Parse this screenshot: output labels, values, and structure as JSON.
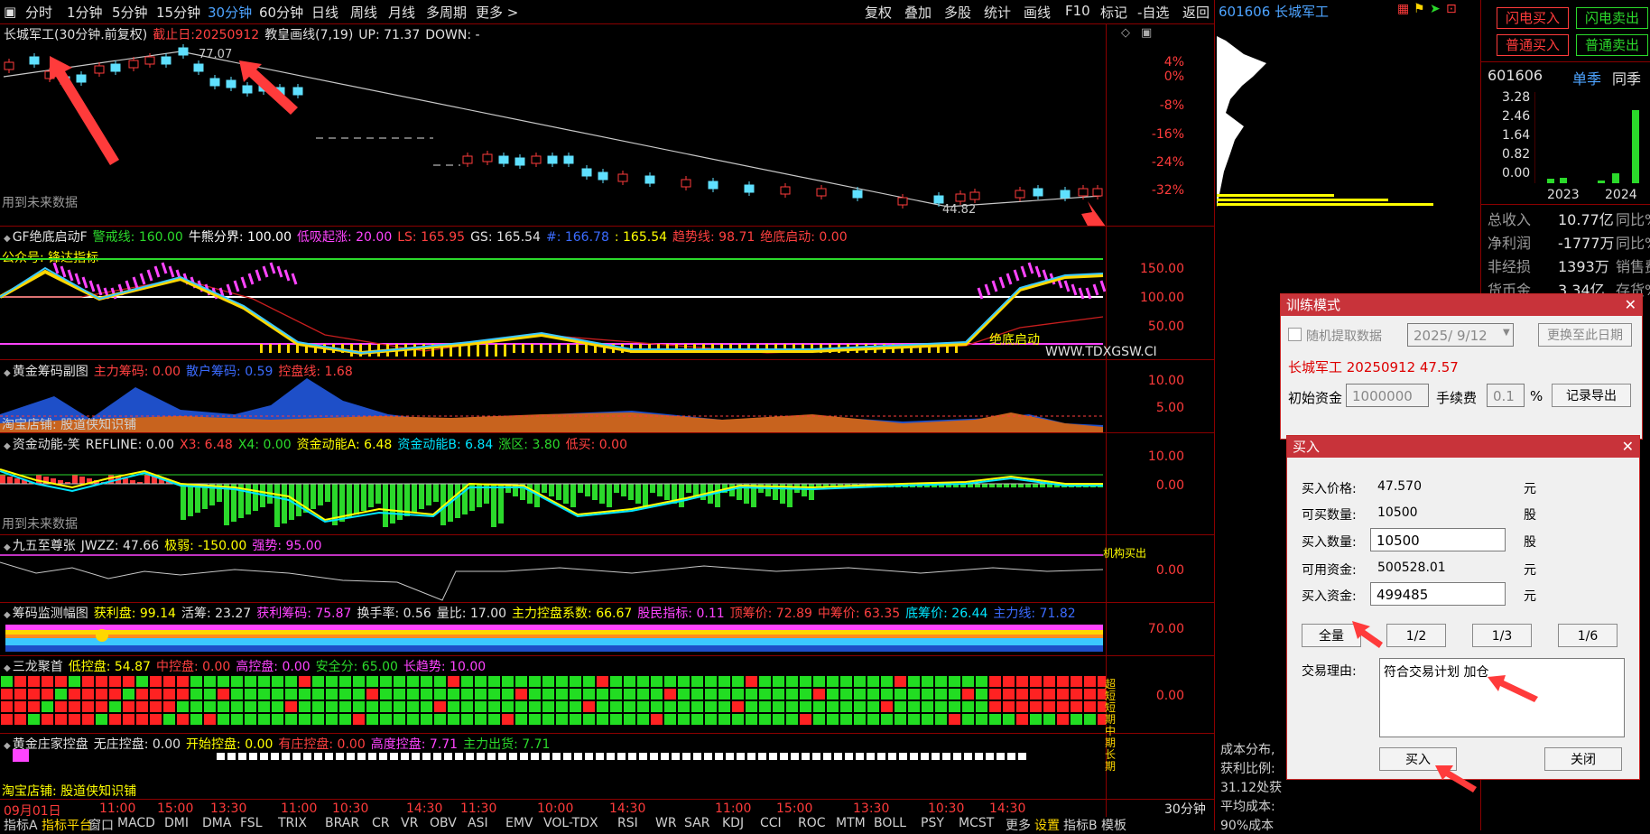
{
  "period_tabs": [
    "分时",
    "1分钟",
    "5分钟",
    "15分钟",
    "30分钟",
    "60分钟",
    "日线",
    "周线",
    "月线",
    "多周期",
    "更多 >"
  ],
  "active_period": "30分钟",
  "toolbar": [
    "复权",
    "叠加",
    "多股",
    "统计",
    "画线",
    "F10",
    "标记",
    "-自选",
    "返回"
  ],
  "stock": {
    "code": "601606",
    "name": "长城军工"
  },
  "main_chart": {
    "title": "长城军工(30分钟.前复权)",
    "deadline": "截止日:20250912",
    "indicator": "教皇画线(7,19)",
    "up": "UP: 71.37",
    "down": "DOWN: -",
    "high_label": "77.07",
    "low_label": "44.82",
    "future_note": "用到未来数据",
    "y_ticks": [
      "4%",
      "0%",
      "-8%",
      "-16%",
      "-24%",
      "-32%"
    ]
  },
  "panel2": {
    "name": "GF绝底启动F",
    "items": [
      {
        "t": "警戒线: 160.00",
        "c": "#2bd92b"
      },
      {
        "t": "牛熊分界: 100.00",
        "c": "#ffffff"
      },
      {
        "t": "低吸起涨: 20.00",
        "c": "#ff44ff"
      },
      {
        "t": "LS: 165.95",
        "c": "#ff4040"
      },
      {
        "t": "GS: 165.54",
        "c": "#e0e0e0"
      },
      {
        "t": "#: 166.78",
        "c": "#3b6bff"
      },
      {
        "t": ": 165.54",
        "c": "#ffff00"
      },
      {
        "t": "趋势线: 98.71",
        "c": "#ff4040"
      },
      {
        "t": "绝底启动: 0.00",
        "c": "#ff4040"
      }
    ],
    "sublabel": "公众号: 锋达指标",
    "y_ticks": [
      "150.00",
      "100.00",
      "50.00"
    ],
    "watermark": "WWW.TDXGSW.CI",
    "start_label": "绝底启动"
  },
  "panel3": {
    "name": "黄金筹码副图",
    "items": [
      {
        "t": "主力筹码: 0.00",
        "c": "#ff4040"
      },
      {
        "t": "散户筹码: 0.59",
        "c": "#3b6bff"
      },
      {
        "t": "控盘线: 1.68",
        "c": "#ff4040"
      }
    ],
    "y_ticks": [
      "10.00",
      "5.00"
    ],
    "sublabel": "淘宝店铺: 股道侠知识铺"
  },
  "panel4": {
    "name": "资金动能-笑",
    "items": [
      {
        "t": "REFLINE: 0.00",
        "c": "#e0e0e0"
      },
      {
        "t": "X3: 6.48",
        "c": "#ff4040"
      },
      {
        "t": "X4: 0.00",
        "c": "#2bd92b"
      },
      {
        "t": "资金动能A: 6.48",
        "c": "#ffff00"
      },
      {
        "t": "资金动能B: 6.84",
        "c": "#00e5ff"
      },
      {
        "t": "涨区: 3.80",
        "c": "#2bd92b"
      },
      {
        "t": "低买: 0.00",
        "c": "#ff4040"
      }
    ],
    "y_ticks": [
      "10.00",
      "0.00"
    ],
    "future_note": "用到未来数据"
  },
  "panel5": {
    "name": "九五至尊张",
    "items": [
      {
        "t": "JWZZ: 47.66",
        "c": "#e0e0e0"
      },
      {
        "t": "极弱: -150.00",
        "c": "#ffff00"
      },
      {
        "t": "强势: 95.00",
        "c": "#ff44ff"
      }
    ],
    "y_ticks": [
      "0.00"
    ],
    "corner": "机构买出"
  },
  "panel6": {
    "name": "筹码监测幅图",
    "items": [
      {
        "t": "获利盘: 99.14",
        "c": "#ffff00"
      },
      {
        "t": "活筹: 23.27",
        "c": "#e0e0e0"
      },
      {
        "t": "获利筹码: 75.87",
        "c": "#ff44ff"
      },
      {
        "t": "换手率: 0.56",
        "c": "#e0e0e0"
      },
      {
        "t": "量比: 17.00",
        "c": "#e0e0e0"
      },
      {
        "t": "主力控盘系数: 66.67",
        "c": "#ffff00"
      },
      {
        "t": "股民指标: 0.11",
        "c": "#ff44ff"
      },
      {
        "t": "顶筹价: 72.89",
        "c": "#ff4040"
      },
      {
        "t": "中筹价: 63.35",
        "c": "#ff4040"
      },
      {
        "t": "底筹价: 26.44",
        "c": "#00e5ff"
      },
      {
        "t": "主力线: 71.82",
        "c": "#3b6bff"
      }
    ],
    "y_ticks": [
      "70.00"
    ]
  },
  "panel7": {
    "name": "三龙聚首",
    "items": [
      {
        "t": "低控盘: 54.87",
        "c": "#ffff00"
      },
      {
        "t": "中控盘: 0.00",
        "c": "#ff4040"
      },
      {
        "t": "高控盘: 0.00",
        "c": "#ff44ff"
      },
      {
        "t": "安全分: 65.00",
        "c": "#2bd92b"
      },
      {
        "t": "长趋势: 10.00",
        "c": "#ff44ff"
      }
    ],
    "y_ticks": [
      "0.00"
    ],
    "side_labels": [
      "超短",
      "短期",
      "中期",
      "长期"
    ]
  },
  "panel8": {
    "name": "黄金庄家控盘",
    "items": [
      {
        "t": "无庄控盘: 0.00",
        "c": "#e0e0e0"
      },
      {
        "t": "开始控盘: 0.00",
        "c": "#ffff00"
      },
      {
        "t": "有庄控盘: 0.00",
        "c": "#ff4040"
      },
      {
        "t": "高度控盘: 7.71",
        "c": "#ff44ff"
      },
      {
        "t": "主力出货: 7.71",
        "c": "#2bd92b"
      }
    ],
    "sublabel": "淘宝店铺: 股道侠知识铺"
  },
  "time_axis": [
    "09月01日",
    "11:00",
    "15:00",
    "13:30",
    "11:00",
    "10:30",
    "14:30",
    "11:30",
    "10:00",
    "14:30",
    "11:00",
    "15:00",
    "13:30",
    "10:30",
    "14:30"
  ],
  "bottom_tabs": [
    "指标A",
    "指标平台",
    "窗口",
    "MACD",
    "DMI",
    "DMA",
    "FSL",
    "TRIX",
    "BRAR",
    "CR",
    "VR",
    "OBV",
    "ASI",
    "EMV",
    "VOL-TDX",
    "RSI",
    "WR",
    "SAR",
    "KDJ",
    "CCI",
    "ROC",
    "MTM",
    "BOLL",
    "PSY",
    "MCST",
    "更多",
    "设置",
    "指标B",
    "模板"
  ],
  "corner_period": "30分钟",
  "right_panel": {
    "code_name": "601606 长城军工",
    "btn_flash_buy": "闪电买入",
    "btn_flash_sell": "闪电卖出",
    "btn_normal_buy": "普通买入",
    "btn_normal_sell": "普通卖出",
    "fin_code": "601606",
    "fin_tab1": "单季",
    "fin_tab2": "同季",
    "fin_ticks": [
      "3.28",
      "2.46",
      "1.64",
      "0.82",
      "0.00"
    ],
    "fin_years": [
      "2023",
      "2024"
    ],
    "fin_rows": [
      {
        "k": "总收入",
        "v": "10.77亿",
        "x": "同比%"
      },
      {
        "k": "净利润",
        "v": "-1777万",
        "x": "同比%"
      },
      {
        "k": "非经损",
        "v": "1393万",
        "x": "销售费"
      },
      {
        "k": "货币金",
        "v": "3.34亿",
        "x": "存货%"
      }
    ],
    "cost_rows": [
      "成本分布,",
      "获利比例:",
      "31.12处获",
      "平均成本:",
      "90%成本"
    ]
  },
  "training_dialog": {
    "title": "训练模式",
    "random_label": "随机提取数据",
    "date": "2025/ 9/12",
    "replace_btn": "更换至此日期",
    "stock_line": "长城军工 20250912 47.57",
    "capital_label": "初始资金",
    "capital": "1000000",
    "fee_label": "手续费",
    "fee": "0.1",
    "pct": "%",
    "export_btn": "记录导出"
  },
  "buy_dialog": {
    "title": "买入",
    "price_label": "买入价格:",
    "price": "47.570",
    "price_unit": "元",
    "avail_label": "可买数量:",
    "avail": "10500",
    "avail_unit": "股",
    "qty_label": "买入数量:",
    "qty": "10500",
    "qty_unit": "股",
    "cash_label": "可用资金:",
    "cash": "500528.01",
    "cash_unit": "元",
    "amount_label": "买入资金:",
    "amount": "499485",
    "amount_unit": "元",
    "btn_all": "全量",
    "btn_half": "1/2",
    "btn_third": "1/3",
    "btn_sixth": "1/6",
    "reason_label": "交易理由:",
    "reason": "符合交易计划 加仓",
    "buy_btn": "买入",
    "close_btn": "关闭"
  }
}
